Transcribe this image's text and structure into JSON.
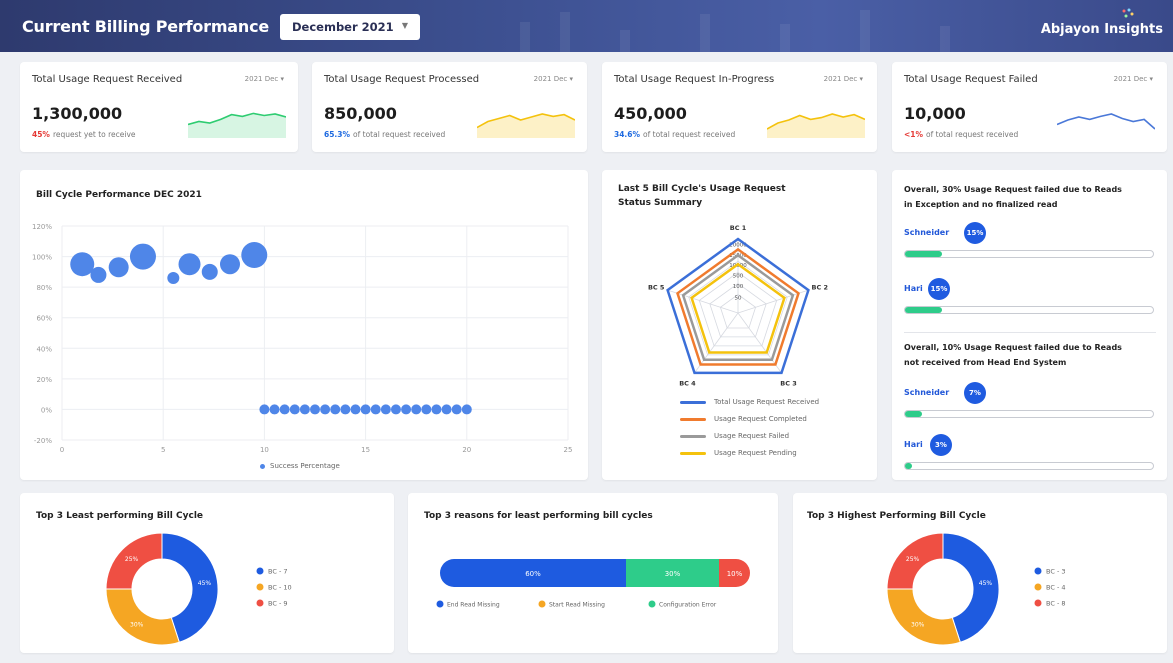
{
  "header": {
    "title": "Current Billing Performance",
    "month": "December 2021",
    "brand": "Abjayon Insights"
  },
  "kpis": [
    {
      "title": "Total Usage Request Received",
      "period": "2021 Dec",
      "value": "1,300,000",
      "pct": "45%",
      "pct_color": "#e53935",
      "sub": "request yet to receive",
      "color": "#2ecc71",
      "fill": "#d7f5e3",
      "trend": [
        0.45,
        0.55,
        0.5,
        0.62,
        0.78,
        0.72,
        0.82,
        0.75,
        0.8,
        0.7
      ]
    },
    {
      "title": "Total Usage Request Processed",
      "period": "2021 Dec",
      "value": "850,000",
      "pct": "65.3%",
      "pct_color": "#1e6ae0",
      "sub": "of total request received",
      "color": "#f4c20d",
      "fill": "#fdf1c7",
      "trend": [
        0.35,
        0.55,
        0.65,
        0.75,
        0.6,
        0.7,
        0.8,
        0.72,
        0.78,
        0.6
      ]
    },
    {
      "title": "Total Usage Request In-Progress",
      "period": "2021 Dec",
      "value": "450,000",
      "pct": "34.6%",
      "pct_color": "#1e6ae0",
      "sub": "of total request received",
      "color": "#f4c20d",
      "fill": "#fdf1c7",
      "trend": [
        0.3,
        0.5,
        0.6,
        0.75,
        0.62,
        0.68,
        0.8,
        0.7,
        0.78,
        0.62
      ]
    },
    {
      "title": "Total Usage Request Failed",
      "period": "2021 Dec",
      "value": "10,000",
      "pct": "<1%",
      "pct_color": "#e53935",
      "sub": "of total request received",
      "color": "#4a78d8",
      "fill": "#ffffff",
      "trend": [
        0.45,
        0.6,
        0.7,
        0.62,
        0.72,
        0.8,
        0.65,
        0.55,
        0.62,
        0.3
      ]
    }
  ],
  "bubble_chart": {
    "title": "Bill Cycle Performance DEC 2021",
    "legend": "Success Percentage",
    "series_color": "#4f86e8"
  },
  "radar": {
    "title_line1": "Last 5 Bill Cycle's Usage Request",
    "title_line2": "Status Summary",
    "legend": [
      {
        "label": "Total Usage Request Received",
        "color": "#3b6fd8"
      },
      {
        "label": "Usage Request Completed",
        "color": "#f07b2e"
      },
      {
        "label": "Usage Request Failed",
        "color": "#9a9a9a"
      },
      {
        "label": "Usage Request Pending",
        "color": "#f4c20d"
      }
    ]
  },
  "failed_panel": {
    "section1": {
      "title_line1": "Overall, 30% Usage Request failed due to Reads",
      "title_line2": "in Exception and no finalized read"
    },
    "section2": {
      "title_line1": "Overall, 10% Usage Request failed due to Reads",
      "title_line2": "not received from Head End System"
    }
  },
  "least_donut": {
    "title": "Top 3 Least performing Bill Cycle"
  },
  "reasons": {
    "title": "Top 3 reasons for least performing bill cycles",
    "segments": [
      {
        "label": "60%",
        "value": 60,
        "color": "#1e5be0"
      },
      {
        "label": "30%",
        "value": 30,
        "color": "#2ecc8a"
      },
      {
        "label": "10%",
        "value": 10,
        "color": "#ef4f43"
      }
    ]
  },
  "highest_donut": {
    "title": "Top 3 Highest Performing Bill Cycle"
  },
  "chart_data": [
    {
      "type": "scatter",
      "title": "Bill Cycle Performance DEC 2021",
      "x_ticks": [
        "0",
        "5",
        "10",
        "15",
        "20",
        "25"
      ],
      "y_ticks": [
        "120%",
        "100%",
        "80%",
        "60%",
        "40%",
        "20%",
        "0%",
        "-20%"
      ],
      "xlim": [
        0,
        25
      ],
      "ylim": [
        -20,
        120
      ],
      "series": [
        {
          "name": "Success Percentage",
          "points": [
            {
              "x": 1,
              "y": 95,
              "size": 12
            },
            {
              "x": 1.8,
              "y": 88,
              "size": 8
            },
            {
              "x": 2.8,
              "y": 93,
              "size": 10
            },
            {
              "x": 4,
              "y": 100,
              "size": 13
            },
            {
              "x": 5.5,
              "y": 86,
              "size": 6
            },
            {
              "x": 6.3,
              "y": 95,
              "size": 11
            },
            {
              "x": 7.3,
              "y": 90,
              "size": 8
            },
            {
              "x": 8.3,
              "y": 95,
              "size": 10
            },
            {
              "x": 9.5,
              "y": 101,
              "size": 13
            },
            {
              "x": 10,
              "y": 0,
              "size": 5
            },
            {
              "x": 10.5,
              "y": 0,
              "size": 5
            },
            {
              "x": 11,
              "y": 0,
              "size": 5
            },
            {
              "x": 11.5,
              "y": 0,
              "size": 5
            },
            {
              "x": 12,
              "y": 0,
              "size": 5
            },
            {
              "x": 12.5,
              "y": 0,
              "size": 5
            },
            {
              "x": 13,
              "y": 0,
              "size": 5
            },
            {
              "x": 13.5,
              "y": 0,
              "size": 5
            },
            {
              "x": 14,
              "y": 0,
              "size": 5
            },
            {
              "x": 14.5,
              "y": 0,
              "size": 5
            },
            {
              "x": 15,
              "y": 0,
              "size": 5
            },
            {
              "x": 15.5,
              "y": 0,
              "size": 5
            },
            {
              "x": 16,
              "y": 0,
              "size": 5
            },
            {
              "x": 16.5,
              "y": 0,
              "size": 5
            },
            {
              "x": 17,
              "y": 0,
              "size": 5
            },
            {
              "x": 17.5,
              "y": 0,
              "size": 5
            },
            {
              "x": 18,
              "y": 0,
              "size": 5
            },
            {
              "x": 18.5,
              "y": 0,
              "size": 5
            },
            {
              "x": 19,
              "y": 0,
              "size": 5
            },
            {
              "x": 19.5,
              "y": 0,
              "size": 5
            },
            {
              "x": 20,
              "y": 0,
              "size": 5
            }
          ]
        }
      ]
    },
    {
      "type": "radar",
      "axes": [
        "BC 1",
        "BC 2",
        "BC 3",
        "BC 4",
        "BC 5"
      ],
      "ring_labels": [
        "20000",
        "15000",
        "10000",
        "500",
        "100",
        "50"
      ],
      "series": [
        {
          "name": "Total Usage Request Received",
          "color": "#3b6fd8",
          "values": [
            1.0,
            1.0,
            1.0,
            1.0,
            1.0
          ]
        },
        {
          "name": "Usage Request Completed",
          "color": "#f07b2e",
          "values": [
            0.86,
            0.86,
            0.86,
            0.86,
            0.86
          ]
        },
        {
          "name": "Usage Request Failed",
          "color": "#9a9a9a",
          "values": [
            0.78,
            0.78,
            0.78,
            0.78,
            0.78
          ]
        },
        {
          "name": "Usage Request Pending",
          "color": "#f4c20d",
          "values": [
            0.66,
            0.66,
            0.66,
            0.66,
            0.66
          ]
        }
      ]
    },
    {
      "type": "pie",
      "title": "Top 3 Least performing Bill Cycle",
      "slices": [
        {
          "label": "BC - 7",
          "value": 45,
          "display": "45%",
          "color": "#1e5be0"
        },
        {
          "label": "BC - 10",
          "value": 30,
          "display": "30%",
          "color": "#f5a623"
        },
        {
          "label": "BC - 9",
          "value": 25,
          "display": "25%",
          "color": "#ef4f43"
        }
      ]
    },
    {
      "type": "bar",
      "title": "Top 3 reasons for least performing bill cycles",
      "categories": [
        "End Read Missing",
        "Start Read Missing",
        "Configuration Error"
      ],
      "values": [
        60,
        30,
        10
      ],
      "colors": [
        "#1e5be0",
        "#f5a623",
        "#2ecc8a"
      ]
    },
    {
      "type": "pie",
      "title": "Top 3 Highest Performing Bill Cycle",
      "slices": [
        {
          "label": "BC - 3",
          "value": 45,
          "display": "45%",
          "color": "#1e5be0"
        },
        {
          "label": "BC - 4",
          "value": 30,
          "display": "30%",
          "color": "#f5a623"
        },
        {
          "label": "BC - 8",
          "value": 25,
          "display": "25%",
          "color": "#ef4f43"
        }
      ]
    }
  ],
  "vendors": {
    "section1": [
      {
        "name": "Schneider",
        "badge": "15%",
        "progress": 0.15
      },
      {
        "name": "Hari",
        "badge": "15%",
        "progress": 0.15
      }
    ],
    "section2": [
      {
        "name": "Schneider",
        "badge": "7%",
        "progress": 0.07
      },
      {
        "name": "Hari",
        "badge": "3%",
        "progress": 0.03
      }
    ]
  }
}
